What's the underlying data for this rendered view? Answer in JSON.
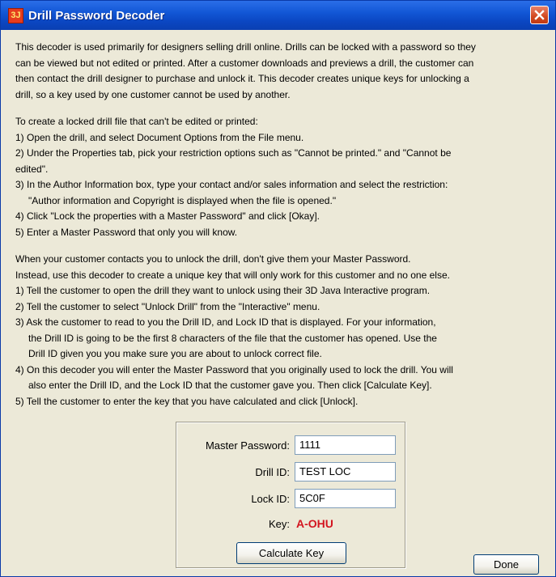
{
  "window": {
    "title": "Drill Password Decoder",
    "icon_text": "3J",
    "close_icon": "close-icon",
    "accent_color": "#0b47c3",
    "close_color": "#d2481f"
  },
  "intro": {
    "lines": [
      "This decoder is used primarily for designers selling drill online. Drills can be locked with a password so they",
      "can be viewed but not edited or printed.  After a customer downloads and previews a drill, the customer can",
      "then contact the drill designer to purchase and unlock it.  This decoder creates unique keys for unlocking a",
      "drill, so a key used by one customer cannot be used by another."
    ]
  },
  "create_steps": {
    "heading": "To create a locked drill file that can't be edited or printed:",
    "lines": [
      "1)  Open the drill, and select Document Options from the File menu.",
      "2)  Under the Properties tab, pick your restriction options such as \"Cannot be printed.\" and \"Cannot be",
      "edited\".",
      "3)  In the Author Information box, type your contact and/or sales information and select the restriction:",
      "\"Author information and Copyright is displayed when the file is opened.\"",
      "4)  Click \"Lock the properties with a Master Password\" and click [Okay].",
      "5)  Enter a Master Password that only you will know."
    ]
  },
  "unlock_steps": {
    "lines": [
      "When your customer contacts you to unlock the drill, don't give them your Master Password.",
      "Instead, use this decoder to create a unique key that will only work for this customer and no one else.",
      "1)  Tell the customer to open the drill they want to unlock using their 3D Java Interactive program.",
      "2)  Tell the customer to select \"Unlock Drill\" from the \"Interactive\" menu.",
      "3)  Ask the customer to read to you the Drill ID, and Lock ID that is displayed.  For your information,",
      "the Drill ID is going to be the first 8 characters of the file that the customer has opened.  Use the",
      "Drill ID given you you make sure you are about to unlock correct file.",
      "4)  On this decoder you will enter the Master Password that you originally used to lock the drill.  You will",
      "also enter the Drill ID, and the Lock ID that the customer gave you.  Then click [Calculate Key].",
      "5)  Tell the customer to enter the key that you have calculated and click [Unlock]."
    ]
  },
  "form": {
    "master_password_label": "Master Password:",
    "master_password_value": "1111",
    "drill_id_label": "Drill ID:",
    "drill_id_value": "TEST LOC",
    "lock_id_label": "Lock ID:",
    "lock_id_value": "5C0F",
    "key_label": "Key:",
    "key_value": "A-OHU",
    "key_color": "#d3151f",
    "calculate_label": "Calculate Key"
  },
  "done_label": "Done"
}
